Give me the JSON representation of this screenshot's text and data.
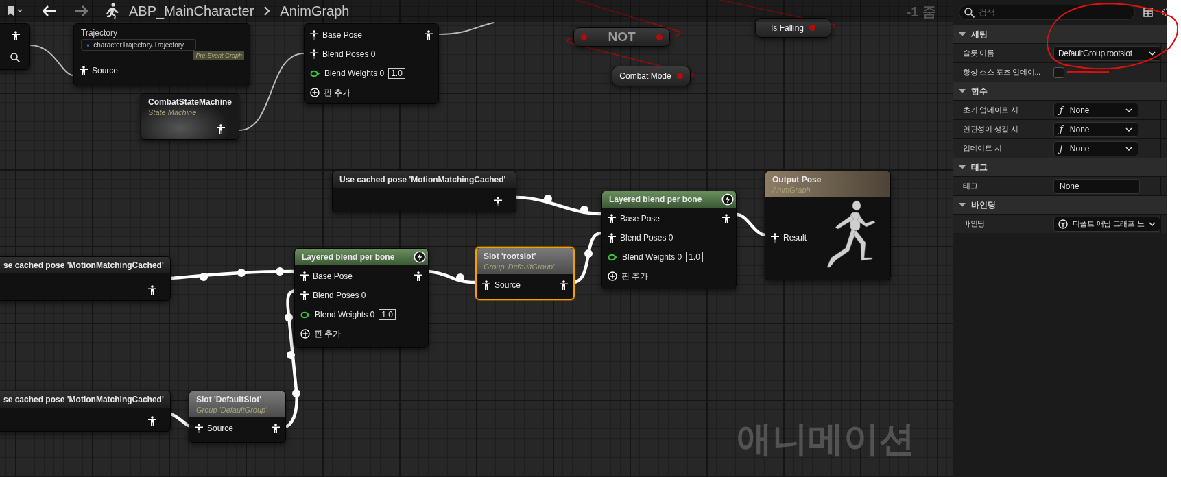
{
  "breadcrumb": {
    "asset": "ABP_MainCharacter",
    "graph": "AnimGraph"
  },
  "zoom_label": "-1 줌",
  "graph_type_label": "애니메이션",
  "nodes": [
    {
      "kind": "trajectory",
      "title": "Trajectory",
      "selector": "characterTrajectory.Trajectory",
      "tag": "Pre-Event Graph",
      "selected": false,
      "pins": [
        {
          "kind": "pose",
          "label": "Source"
        }
      ]
    },
    {
      "kind": "blend",
      "selected": false,
      "pins": [
        {
          "kind": "pose-through",
          "label": "Base Pose"
        },
        {
          "kind": "pose",
          "label": "Blend Poses 0"
        },
        {
          "kind": "weight",
          "label": "Blend Weights 0",
          "value": "1.0"
        },
        {
          "kind": "add",
          "label": "핀 추가"
        }
      ]
    },
    {
      "kind": "operator",
      "title": "NOT",
      "selected": false
    },
    {
      "kind": "variable",
      "title": "Is Falling",
      "selected": false
    },
    {
      "kind": "variable",
      "title": "Combat Mode",
      "selected": false
    },
    {
      "kind": "state-machine",
      "title": "CombatStateMachine",
      "subtitle": "State Machine",
      "selected": false
    },
    {
      "kind": "cached",
      "title": "Use cached pose 'MotionMatchingCached'",
      "selected": false
    },
    {
      "kind": "blend",
      "title": "Layered blend per bone",
      "fast_path": true,
      "selected": false,
      "pins": [
        {
          "kind": "pose-through",
          "label": "Base Pose"
        },
        {
          "kind": "pose",
          "label": "Blend Poses 0"
        },
        {
          "kind": "weight",
          "label": "Blend Weights 0",
          "value": "1.0"
        },
        {
          "kind": "add",
          "label": "핀 추가"
        }
      ]
    },
    {
      "kind": "output",
      "title": "Output Pose",
      "subtitle": "AnimGraph",
      "selected": false,
      "pins": [
        {
          "kind": "pose",
          "label": "Result"
        }
      ]
    },
    {
      "kind": "cached",
      "title": "se cached pose 'MotionMatchingCached'",
      "selected": false
    },
    {
      "kind": "blend",
      "title": "Layered blend per bone",
      "fast_path": true,
      "selected": false,
      "pins": [
        {
          "kind": "pose-through",
          "label": "Base Pose"
        },
        {
          "kind": "pose",
          "label": "Blend Poses 0"
        },
        {
          "kind": "weight",
          "label": "Blend Weights 0",
          "value": "1.0"
        },
        {
          "kind": "add",
          "label": "핀 추가"
        }
      ]
    },
    {
      "kind": "slot",
      "title": "Slot 'rootslot'",
      "subtitle": "Group 'DefaultGroup'",
      "selected": true,
      "pins": [
        {
          "kind": "pose-through",
          "label": "Source"
        }
      ]
    },
    {
      "kind": "cached",
      "title": "se cached pose 'MotionMatchingCached'",
      "selected": false
    },
    {
      "kind": "slot",
      "title": "Slot 'DefaultSlot'",
      "subtitle": "Group 'DefaultGroup'",
      "selected": false,
      "pins": [
        {
          "kind": "pose-through",
          "label": "Source"
        }
      ]
    }
  ],
  "details": {
    "search": {
      "placeholder": "검색"
    },
    "sections": [
      {
        "title": "세팅",
        "expanded": true,
        "rows": [
          {
            "label": "슬롯 이름",
            "kind": "dropdown",
            "value": "DefaultGroup.rootslot"
          },
          {
            "label": "항상 소스 포즈 업데이...",
            "kind": "checkbox",
            "checked": false
          }
        ]
      },
      {
        "title": "함수",
        "expanded": true,
        "rows": [
          {
            "label": "초기 업데이트 시",
            "kind": "function",
            "glyph": "ƒ",
            "value": "None"
          },
          {
            "label": "연관성이 생길 시",
            "kind": "function",
            "glyph": "ƒ",
            "value": "None"
          },
          {
            "label": "업데이트 시",
            "kind": "function",
            "glyph": "ƒ",
            "value": "None"
          }
        ]
      },
      {
        "title": "태그",
        "expanded": true,
        "rows": [
          {
            "label": "태그",
            "kind": "text",
            "value": "None"
          }
        ]
      },
      {
        "title": "바인딩",
        "expanded": true,
        "rows": [
          {
            "label": "바인딩",
            "kind": "binding",
            "value": "디폴트 애님 그래프 노"
          }
        ]
      }
    ]
  }
}
